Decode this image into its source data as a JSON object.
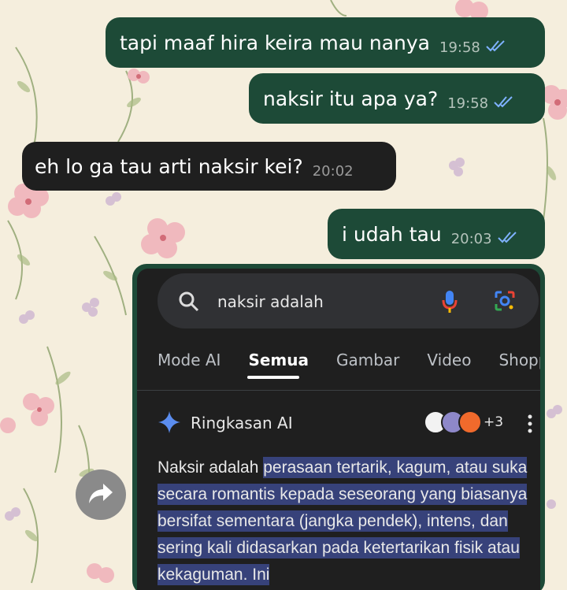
{
  "messages": [
    {
      "direction": "out",
      "text": "tapi maaf hira keira mau nanya",
      "time": "19:58",
      "status": "read"
    },
    {
      "direction": "out",
      "text": "naksir itu apa ya?",
      "time": "19:58",
      "status": "read"
    },
    {
      "direction": "in",
      "text": "eh lo ga tau arti naksir kei?",
      "time": "20:02"
    },
    {
      "direction": "out",
      "text": "i udah tau",
      "time": "20:03",
      "status": "read"
    }
  ],
  "screenshot": {
    "search_query": "naksir adalah",
    "tabs": [
      "Mode AI",
      "Semua",
      "Gambar",
      "Video",
      "Shopp"
    ],
    "active_tab": "Semua",
    "ai_overview_title": "Ringkasan AI",
    "source_count": "+3",
    "summary_plain": "Naksir adalah ",
    "summary_highlight": "perasaan tertarik, kagum, atau suka secara romantis kepada seseorang yang biasanya bersifat sementara (jangka pendek), intens, dan sering kali didasarkan pada ketertarikan fisik atau kekaguman. Ini"
  },
  "colors": {
    "outgoing_bubble": "#1d4a37",
    "incoming_bubble": "#1f1f1f",
    "read_ticks": "#7fb2ff",
    "highlight": "#37427a",
    "wallpaper": "#f5eedd"
  },
  "icons": [
    "search-icon",
    "mic-icon",
    "lens-icon",
    "sparkle-icon",
    "kebab-icon",
    "forward-icon",
    "double-check-icon"
  ]
}
